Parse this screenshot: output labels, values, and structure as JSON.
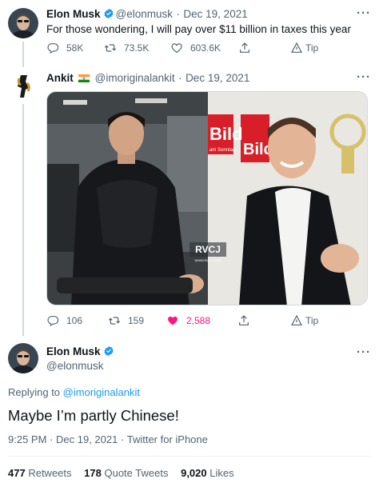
{
  "tweet1": {
    "name": "Elon Musk",
    "handle": "@elonmusk",
    "dot": "·",
    "date": "Dec 19, 2021",
    "text": "For those wondering, I will pay over $11 billion in taxes this year",
    "actions": {
      "replies": "58K",
      "retweets": "73.5K",
      "likes": "603.6K",
      "tip": "Tip"
    }
  },
  "tweet2": {
    "name": "Ankit",
    "flag_icon": "india-flag-icon",
    "handle": "@imoriginalankit",
    "dot": "·",
    "date": "Dec 19, 2021",
    "media_watermark": "RVCJ",
    "media_watermark_sub": "WWW.RVCJ.COM",
    "media_bg_text_1": "Bild",
    "media_bg_text_2": "Bild",
    "media_bg_text_3": "am Sonntag",
    "actions": {
      "replies": "106",
      "retweets": "159",
      "likes": "2,588",
      "tip": "Tip"
    }
  },
  "main": {
    "name": "Elon Musk",
    "handle": "@elonmusk",
    "replying_prefix": "Replying to",
    "replying_to": "@imoriginalankit",
    "text": "Maybe I’m partly Chinese!",
    "time": "9:25 PM",
    "dot": "·",
    "date": "Dec 19, 2021",
    "dot2": "·",
    "source": "Twitter for iPhone",
    "stats": {
      "retweets_count": "477",
      "retweets_label": "Retweets",
      "quotes_count": "178",
      "quotes_label": "Quote Tweets",
      "likes_count": "9,020",
      "likes_label": "Likes"
    }
  },
  "colors": {
    "verified": "#1d9bf0",
    "like_active": "#f91880",
    "link": "#1d9bf0",
    "secondary": "#536471"
  }
}
